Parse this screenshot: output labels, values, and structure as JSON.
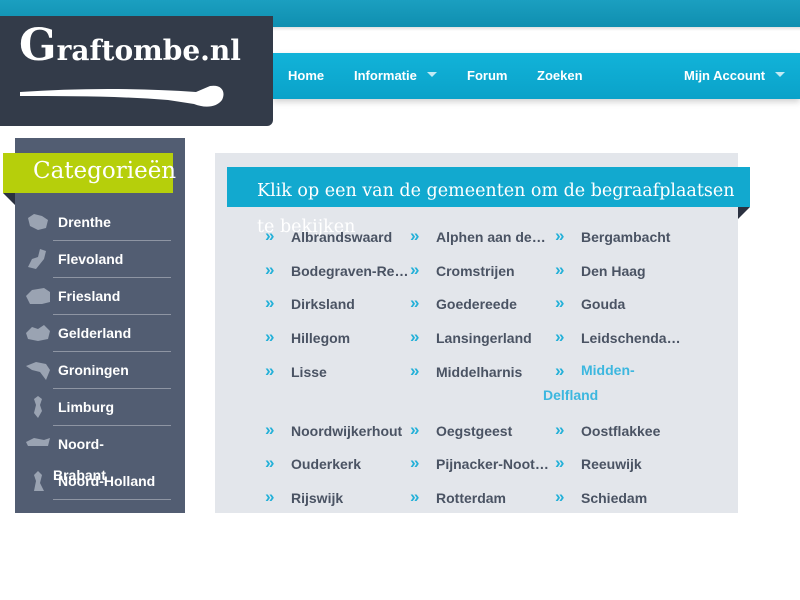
{
  "logo": {
    "letter": "G",
    "rest": "raftombe.nl"
  },
  "nav": {
    "home": "Home",
    "informatie": "Informatie",
    "forum": "Forum",
    "zoeken": "Zoeken",
    "account": "Mijn Account"
  },
  "sidebar": {
    "title": "Categorieën",
    "items": [
      {
        "label": "Drenthe",
        "icon": "drenthe-map-icon"
      },
      {
        "label": "Flevoland",
        "icon": "flevoland-map-icon"
      },
      {
        "label": "Friesland",
        "icon": "friesland-map-icon"
      },
      {
        "label": "Gelderland",
        "icon": "gelderland-map-icon"
      },
      {
        "label": "Groningen",
        "icon": "groningen-map-icon"
      },
      {
        "label": "Limburg",
        "icon": "limburg-map-icon"
      },
      {
        "label": "Noord-",
        "label2": "Brabant",
        "icon": "noord-brabant-map-icon"
      },
      {
        "label": "Noord-Holland",
        "icon": "noord-holland-map-icon"
      }
    ]
  },
  "main": {
    "heading": "Klik op een van de gemeenten om de begraafplaatsen te bekijken",
    "municipalities": [
      [
        "Albrandswaard",
        "Alphen aan den Rijn",
        "Bergambacht"
      ],
      [
        "Bodegraven-Reeuwijk",
        "Cromstrijen",
        "Den Haag"
      ],
      [
        "Dirksland",
        "Goedereede",
        "Gouda"
      ],
      [
        "Hillegom",
        "Lansingerland",
        "Leidschendam-Voorburg"
      ],
      [
        "Lisse",
        "Middelharnis",
        "Midden-Delfland"
      ],
      [
        "Noordwijkerhout",
        "Oegstgeest",
        "Oostflakkee"
      ],
      [
        "Ouderkerk",
        "Pijnacker-Nootdorp",
        "Reeuwijk"
      ],
      [
        "Rijswijk",
        "Rotterdam",
        "Schiedam"
      ]
    ],
    "chevron": "»"
  },
  "colors": {
    "accent_blue": "#12a9cf",
    "sidebar_bg": "#525d72",
    "category_green": "#b6cf0b",
    "logo_bg": "#333b49",
    "active_link": "#3cb7df"
  }
}
